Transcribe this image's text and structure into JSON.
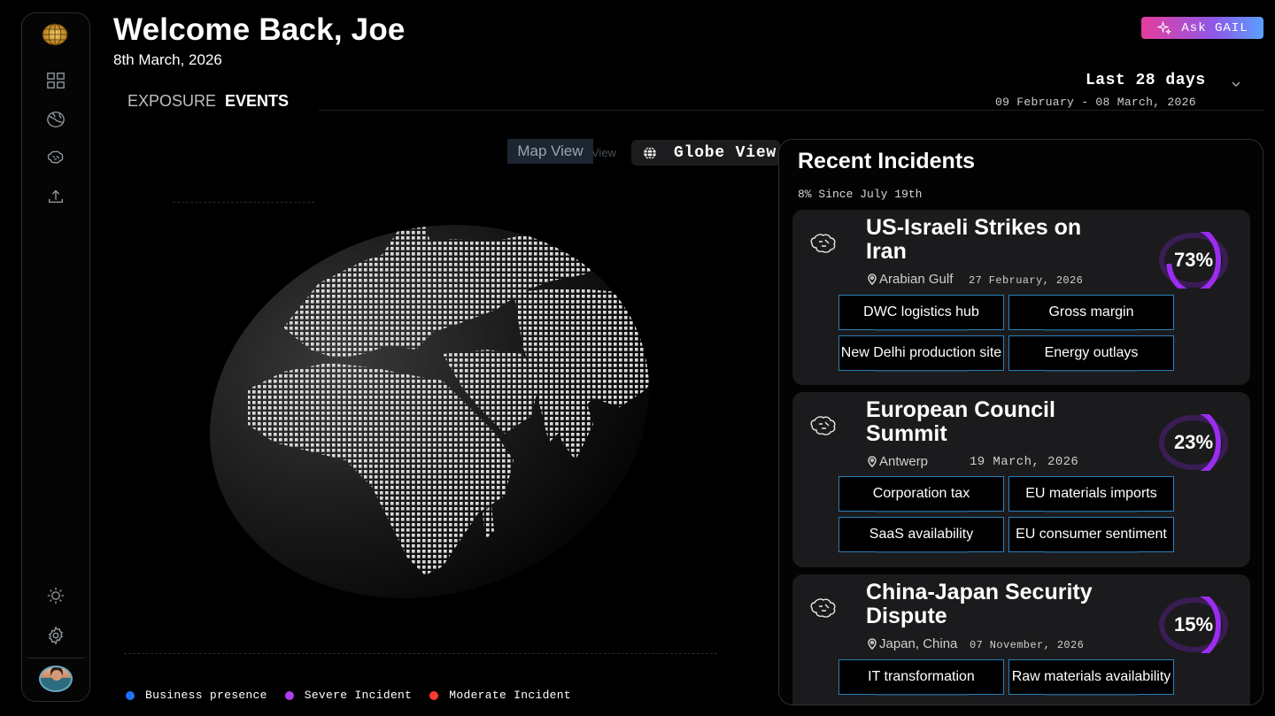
{
  "header": {
    "welcome": "Welcome Back, Joe",
    "date": "8th March, 2026",
    "tabs": [
      {
        "label": "EXPOSURE",
        "active": false
      },
      {
        "label": "EVENTS",
        "active": true
      }
    ],
    "ask_label": "Ask GAIL"
  },
  "range": {
    "title": "Last 28 days",
    "subtitle": "09 February - 08 March, 2026"
  },
  "view_toggle": {
    "map_label": "Map View",
    "ghost_label": "View",
    "globe_label": "Globe View"
  },
  "legend": [
    {
      "label": "Business presence",
      "color": "#1e73ff"
    },
    {
      "label": "Severe Incident",
      "color": "#b03df0"
    },
    {
      "label": "Moderate Incident",
      "color": "#ff3b2f"
    }
  ],
  "incidents": {
    "title": "Recent Incidents",
    "subtitle": "8% Since July 19th",
    "cards": [
      {
        "title": "US-Israeli Strikes on Iran",
        "location": "Arabian Gulf",
        "date": "27 February, 2026",
        "percent": "73%",
        "value": 73,
        "tags": [
          "DWC logistics hub",
          "Gross margin",
          "New Delhi production site",
          "Energy outlays"
        ]
      },
      {
        "title": "European Council Summit",
        "location": "Antwerp",
        "date": "19 March, 2026",
        "percent": "23%",
        "value": 23,
        "tags": [
          "Corporation tax",
          "EU materials imports",
          "SaaS availability",
          "EU consumer sentiment"
        ]
      },
      {
        "title": "China-Japan Security Dispute",
        "location": "Japan, China",
        "date": "07 November, 2026",
        "percent": "15%",
        "value": 15,
        "tags": [
          "IT transformation",
          "Raw materials availability"
        ]
      }
    ]
  },
  "colors": {
    "accent_purple": "#9b2cf0",
    "chip_border": "#2b7fb8",
    "gail_gradient": [
      "#e63d9c",
      "#8d59e8",
      "#5aa0ff"
    ]
  }
}
